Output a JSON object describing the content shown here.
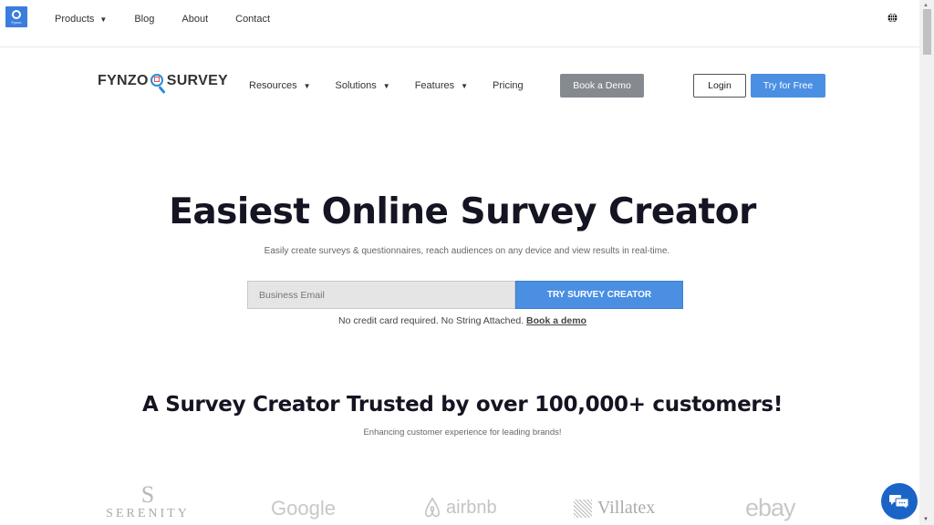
{
  "topbar": {
    "logo_text": "Fynzo",
    "nav": [
      {
        "label": "Products",
        "has_dropdown": true
      },
      {
        "label": "Blog",
        "has_dropdown": false
      },
      {
        "label": "About",
        "has_dropdown": false
      },
      {
        "label": "Contact",
        "has_dropdown": false
      }
    ],
    "globe_icon": "globe-icon"
  },
  "header": {
    "brand_left": "FYNZO",
    "brand_right": "SURVEY",
    "nav": [
      {
        "label": "Resources",
        "has_dropdown": true
      },
      {
        "label": "Solutions",
        "has_dropdown": true
      },
      {
        "label": "Features",
        "has_dropdown": true
      },
      {
        "label": "Pricing",
        "has_dropdown": false
      }
    ],
    "book_demo_label": "Book a Demo",
    "login_label": "Login",
    "try_free_label": "Try for Free"
  },
  "hero": {
    "title": "Easiest Online Survey Creator",
    "subtitle": "Easily create surveys & questionnaires, reach audiences on any device and view results in real-time.",
    "email_placeholder": "Business Email",
    "email_value": "",
    "cta_label": "TRY SURVEY CREATOR",
    "note_text": "No credit card required. No String Attached.",
    "note_link": "Book a demo"
  },
  "trust": {
    "title": "A Survey Creator Trusted by over 100,000+ customers!",
    "subtitle": "Enhancing customer experience for leading brands!",
    "logos": [
      {
        "name": "Serenity",
        "mark": "S",
        "text": "SERENITY"
      },
      {
        "name": "Google",
        "text": "Google"
      },
      {
        "name": "airbnb",
        "text": "airbnb"
      },
      {
        "name": "Villatex",
        "text": "Villatex"
      },
      {
        "name": "ebay",
        "text": "ebay"
      }
    ]
  },
  "colors": {
    "primary_blue": "#4a8fe2",
    "demo_gray": "#858a91",
    "chat_blue": "#1a64c8",
    "heading": "#141422"
  },
  "chat": {
    "icon": "chat-icon"
  }
}
